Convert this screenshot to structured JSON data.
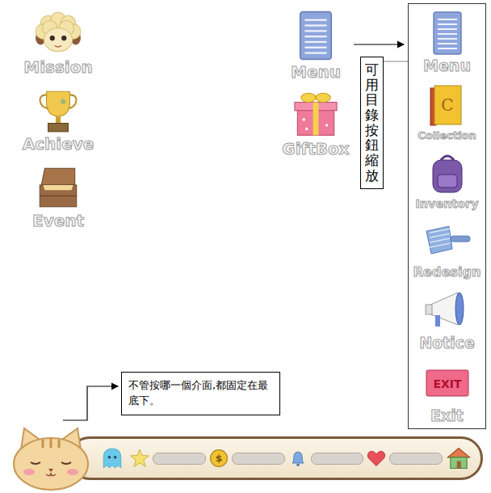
{
  "left_buttons": [
    {
      "label": "Mission"
    },
    {
      "label": "Achieve"
    },
    {
      "label": "Event"
    }
  ],
  "top_buttons": [
    {
      "label": "Menu"
    },
    {
      "label": "GiftBox"
    }
  ],
  "menu_note": "可用目錄按鈕縮放",
  "menu_panel": {
    "expanded": true,
    "items": [
      {
        "label": "Menu",
        "badge": ""
      },
      {
        "label": "Collection",
        "badge": "C"
      },
      {
        "label": "Inventory",
        "badge": ""
      },
      {
        "label": "Redesign",
        "badge": ""
      },
      {
        "label": "Notice",
        "badge": ""
      },
      {
        "label": "Exit",
        "badge": "EXIT"
      }
    ]
  },
  "bar_note": "不管按哪一個介面,都固定在最底下。",
  "status_bar": {
    "stats": [
      {
        "kind": "star",
        "symbol": "",
        "level": 0
      },
      {
        "kind": "coin",
        "symbol": "$",
        "level": 0
      },
      {
        "kind": "bell",
        "symbol": "",
        "level": 0
      },
      {
        "kind": "heart",
        "symbol": "",
        "level": 0
      }
    ]
  }
}
